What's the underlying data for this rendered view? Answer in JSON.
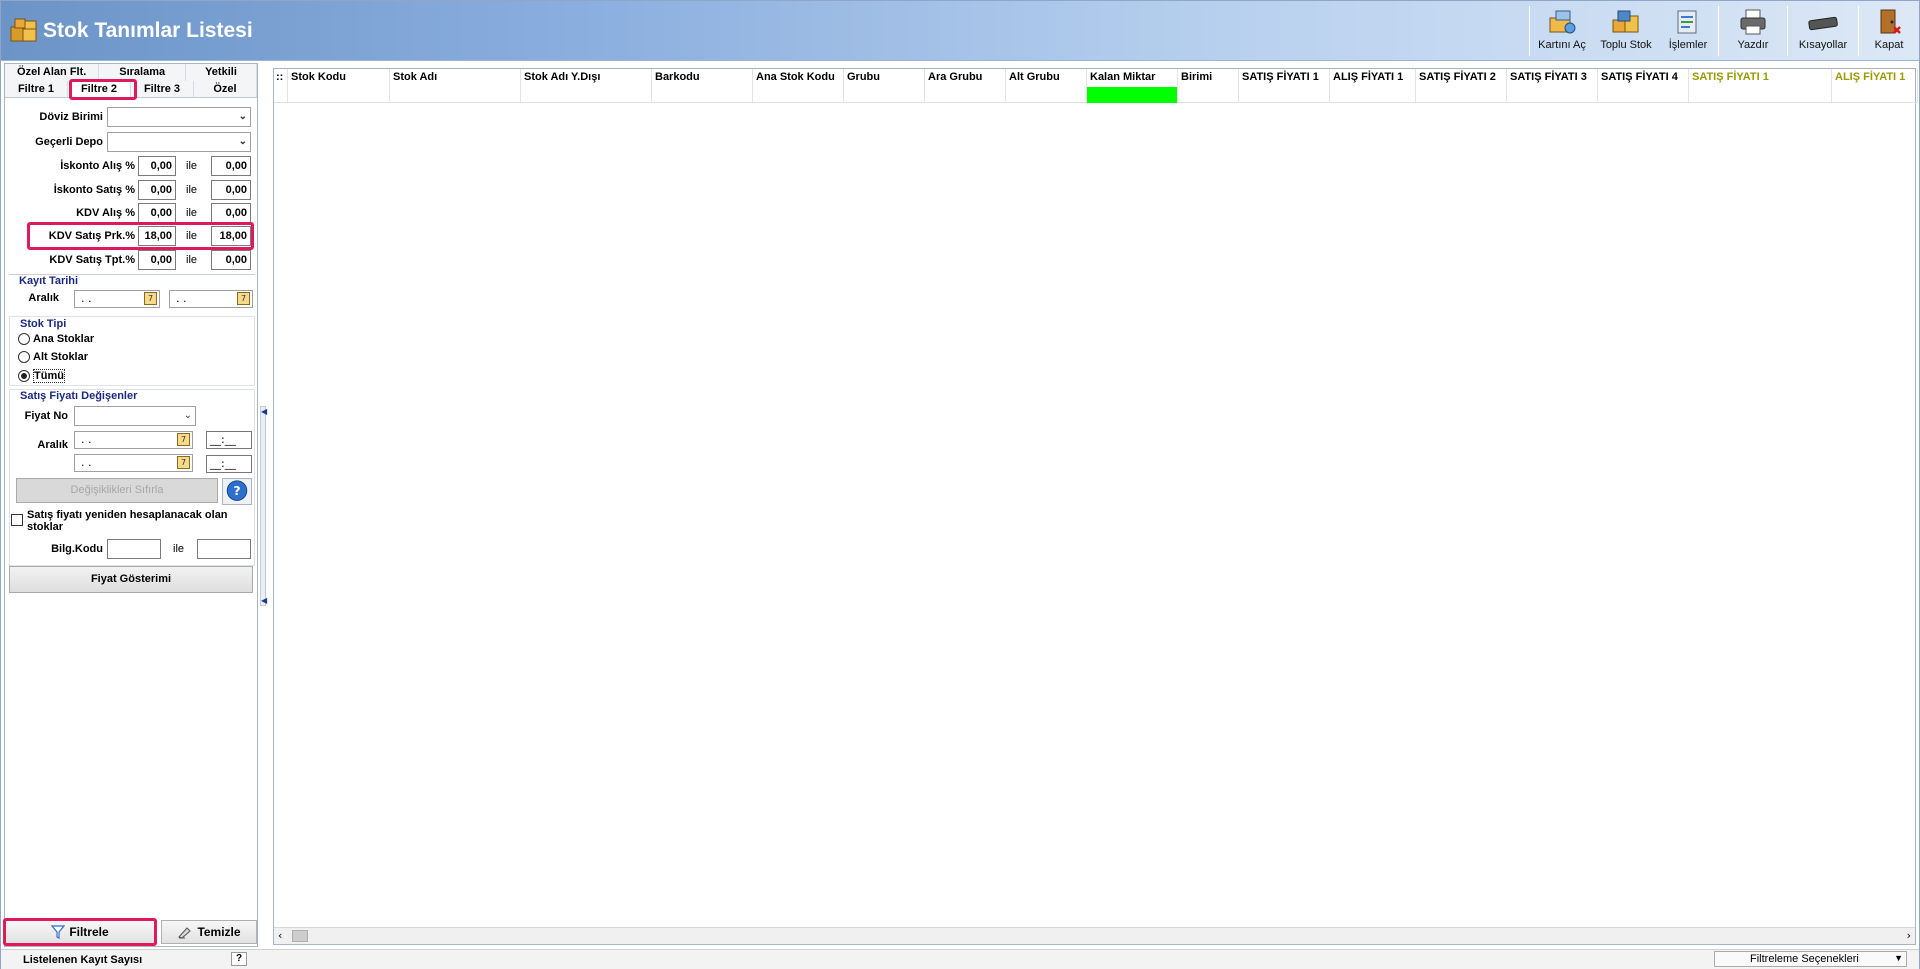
{
  "window": {
    "title": "Stok Tanımlar Listesi"
  },
  "toolbar": [
    {
      "label": "Kartını Aç",
      "icon": "open-card-icon"
    },
    {
      "label": "Toplu Stok",
      "icon": "bulk-stock-icon"
    },
    {
      "label": "İşlemler",
      "icon": "operations-icon"
    },
    {
      "label": "Yazdır",
      "icon": "printer-icon"
    },
    {
      "label": "Kısayollar",
      "icon": "keyboard-icon"
    },
    {
      "label": "Kapat",
      "icon": "close-door-icon"
    }
  ],
  "tabs": {
    "row1": [
      "Özel Alan Flt.",
      "Sıralama",
      "Yetkili"
    ],
    "row2": [
      "Filtre 1",
      "Filtre 2",
      "Filtre 3",
      "Özel"
    ],
    "active": "Filtre 2"
  },
  "filters": {
    "doviz_birimi": {
      "label": "Döviz Birimi",
      "value": ""
    },
    "gecerli_depo": {
      "label": "Geçerli Depo",
      "value": ""
    },
    "ile": "ile",
    "ranges": [
      {
        "label": "İskonto Alış %",
        "from": "0,00",
        "to": "0,00"
      },
      {
        "label": "İskonto Satış %",
        "from": "0,00",
        "to": "0,00"
      },
      {
        "label": "KDV Alış %",
        "from": "0,00",
        "to": "0,00"
      },
      {
        "label": "KDV Satış Prk.%",
        "from": "18,00",
        "to": "18,00"
      },
      {
        "label": "KDV Satış Tpt.%",
        "from": "0,00",
        "to": "0,00"
      }
    ]
  },
  "kayit_tarihi": {
    "title": "Kayıt Tarihi",
    "aralik_label": "Aralık",
    "from": ". .",
    "to": ". ."
  },
  "stok_tipi": {
    "title": "Stok Tipi",
    "options": [
      "Ana Stoklar",
      "Alt Stoklar",
      "Tümü"
    ],
    "selected": "Tümü"
  },
  "satis_fiyati": {
    "title": "Satış Fiyatı Değişenler",
    "fiyat_no_label": "Fiyat No",
    "fiyat_no_value": "",
    "aralik_label": "Aralık",
    "date_from": ". .",
    "date_to": ". .",
    "time_from": "__:__",
    "time_to": "__:__",
    "reset_button": "Değişiklikleri Sıfırla"
  },
  "recalc_checkbox": {
    "label": "Satış fiyatı yeniden hesaplanacak olan stoklar",
    "checked": false
  },
  "bilg_kodu": {
    "label": "Bilg.Kodu",
    "ile": "ile",
    "from": "",
    "to": ""
  },
  "fiyat_gosterimi_button": "Fiyat Gösterimi",
  "bottom_buttons": {
    "filtrele": "Filtrele",
    "temizle": "Temizle"
  },
  "grid": {
    "columns": [
      "Stok Kodu",
      "Stok Adı",
      "Stok Adı Y.Dışı",
      "Barkodu",
      "Ana Stok Kodu",
      "Grubu",
      "Ara Grubu",
      "Alt Grubu",
      "Kalan Miktar",
      "Birimi",
      "SATIŞ FİYATI 1",
      "ALIŞ FİYATI 1",
      "SATIŞ FİYATI 2",
      "SATIŞ FİYATI 3",
      "SATIŞ FİYATI 4",
      "SATIŞ FİYATI 1",
      "ALIŞ FİYATI 1"
    ],
    "highlight_color": "#00ff00"
  },
  "status": {
    "listed_label": "Listelenen Kayıt Sayısı",
    "help": "?",
    "filter_options": "Filtreleme Seçenekleri"
  },
  "colors": {
    "accent_highlight": "#e0195b",
    "group_title": "#1a2a82",
    "olive_header": "#9a9a00"
  }
}
